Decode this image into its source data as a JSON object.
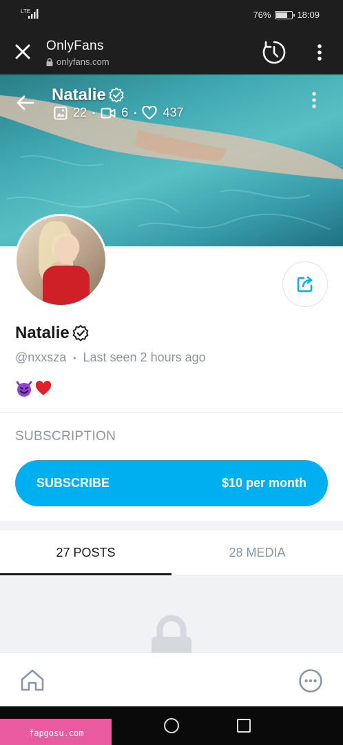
{
  "status_bar": {
    "network": "LTE",
    "battery": "76%",
    "battery_level": 0.76,
    "time": "18:09"
  },
  "browser": {
    "title": "OnlyFans",
    "url": "onlyfans.com",
    "icons": [
      "close-icon",
      "lock-icon",
      "history-icon",
      "overflow-menu-icon"
    ]
  },
  "cover": {
    "name": "Natalie",
    "photos_count": "22",
    "videos_count": "6",
    "likes_count": "437",
    "separator": "•"
  },
  "profile": {
    "name": "Natalie",
    "handle": "@nxxsza",
    "separator": "•",
    "last_seen": "Last seen 2 hours ago",
    "bio_emojis": [
      "smiling-devil-emoji",
      "red-heart-emoji"
    ]
  },
  "subscription": {
    "section_label": "SUBSCRIPTION",
    "button_label": "SUBSCRIBE",
    "price": "$10 per month",
    "accent_color": "#00aff0"
  },
  "tabs": [
    {
      "label": "27 POSTS",
      "active": true
    },
    {
      "label": "28 MEDIA",
      "active": false
    }
  ],
  "bottom_nav": {
    "icons": [
      "home-icon",
      "more-options-icon"
    ]
  },
  "watermark": "fapgosu.com"
}
